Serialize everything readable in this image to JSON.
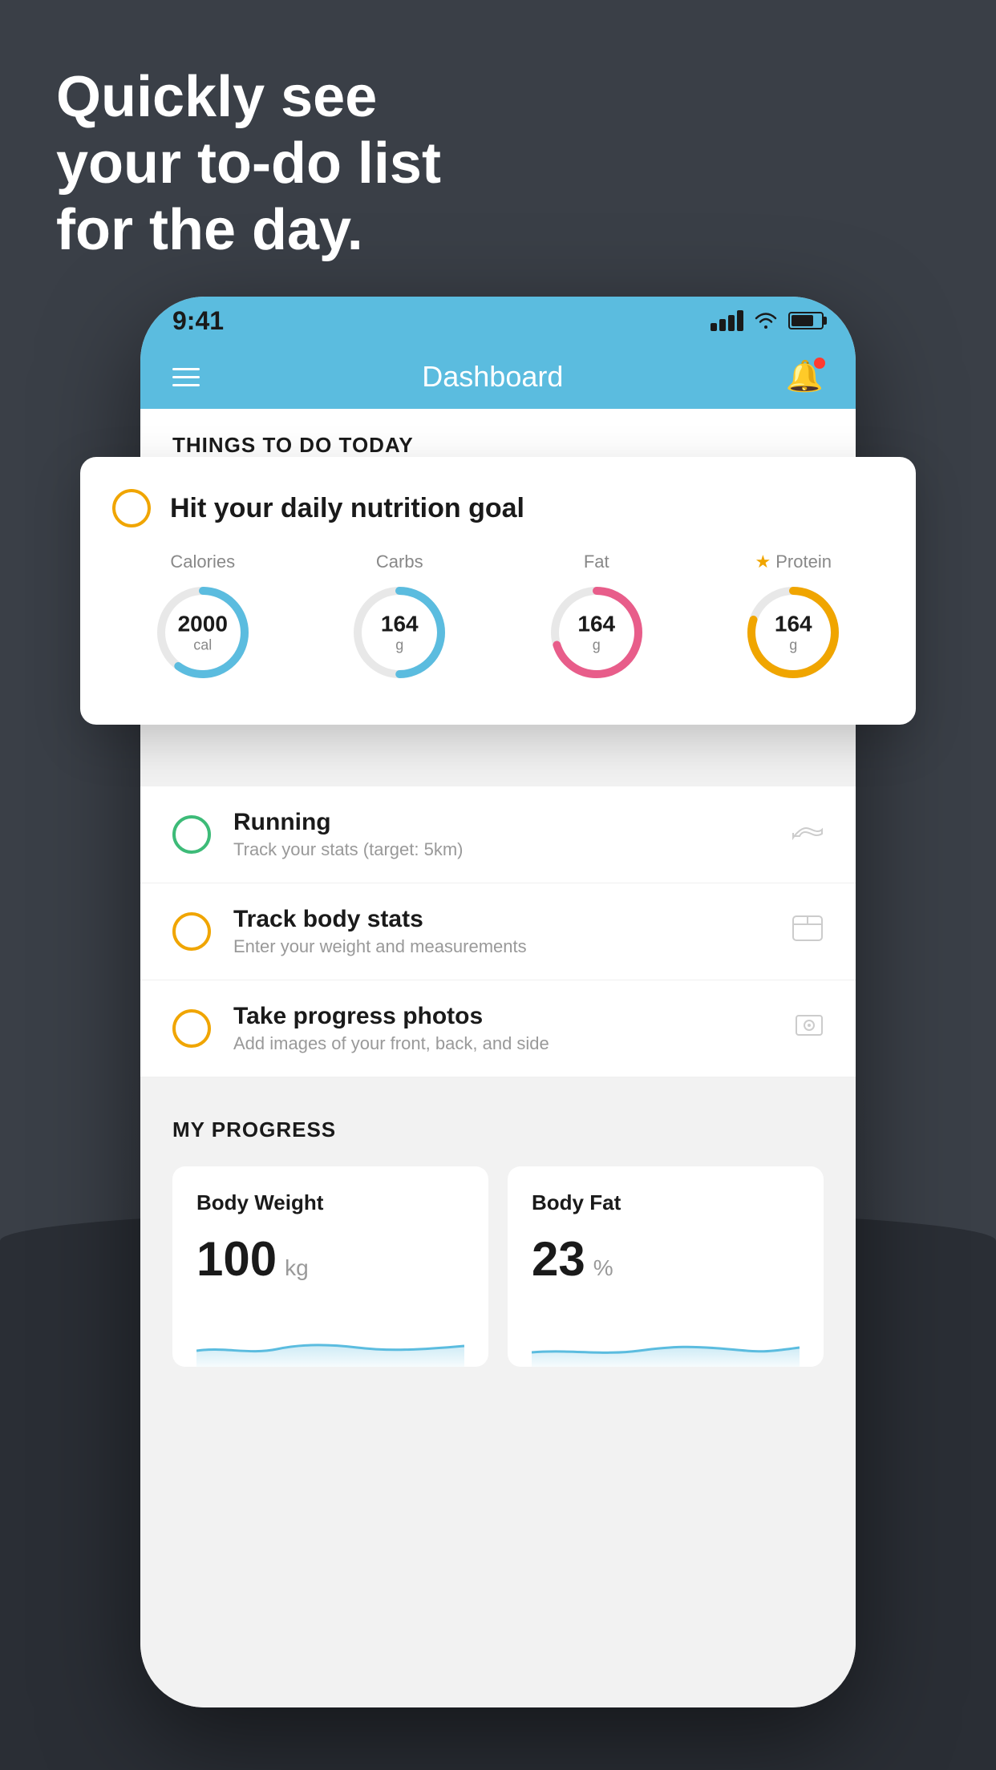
{
  "background": {
    "color": "#3a3f47"
  },
  "headline": {
    "line1": "Quickly see",
    "line2": "your to-do list",
    "line3": "for the day."
  },
  "status_bar": {
    "time": "9:41",
    "signal": "signal-icon",
    "wifi": "wifi-icon",
    "battery": "battery-icon"
  },
  "nav": {
    "menu_icon": "menu-icon",
    "title": "Dashboard",
    "notification_icon": "bell-icon"
  },
  "things_to_do": {
    "section_label": "THINGS TO DO TODAY"
  },
  "nutrition_card": {
    "checkbox_state": "unchecked",
    "title": "Hit your daily nutrition goal",
    "metrics": [
      {
        "label": "Calories",
        "value": "2000",
        "unit": "cal",
        "color": "#5bbcdf",
        "progress": 0.6
      },
      {
        "label": "Carbs",
        "value": "164",
        "unit": "g",
        "color": "#5bbcdf",
        "progress": 0.5
      },
      {
        "label": "Fat",
        "value": "164",
        "unit": "g",
        "color": "#e85d8a",
        "progress": 0.7
      },
      {
        "label": "Protein",
        "value": "164",
        "unit": "g",
        "color": "#f0a500",
        "progress": 0.8,
        "starred": true
      }
    ]
  },
  "todo_items": [
    {
      "id": "running",
      "title": "Running",
      "subtitle": "Track your stats (target: 5km)",
      "circle_color": "#3dbb78",
      "icon": "shoe-icon"
    },
    {
      "id": "body-stats",
      "title": "Track body stats",
      "subtitle": "Enter your weight and measurements",
      "circle_color": "#f0a500",
      "icon": "scale-icon"
    },
    {
      "id": "progress-photos",
      "title": "Take progress photos",
      "subtitle": "Add images of your front, back, and side",
      "circle_color": "#f0a500",
      "icon": "photo-icon"
    }
  ],
  "my_progress": {
    "section_label": "MY PROGRESS",
    "cards": [
      {
        "id": "body-weight",
        "title": "Body Weight",
        "value": "100",
        "unit": "kg"
      },
      {
        "id": "body-fat",
        "title": "Body Fat",
        "value": "23",
        "unit": "%"
      }
    ]
  }
}
